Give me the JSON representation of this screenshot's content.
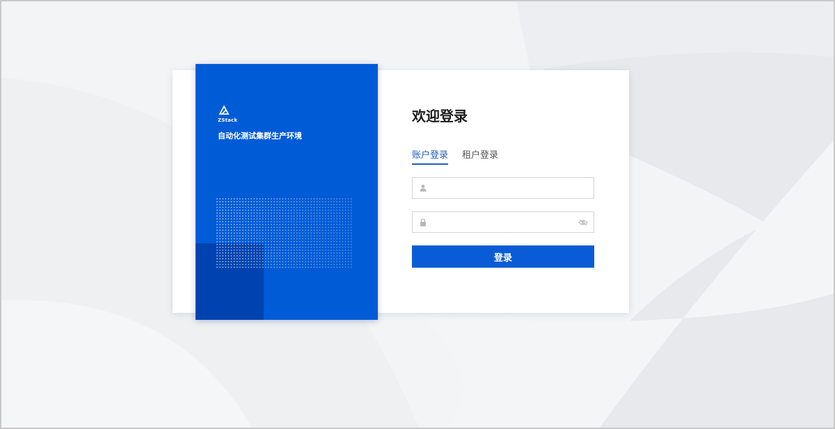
{
  "brand": {
    "logo_text": "ZStack",
    "environment_name": "自动化测试集群生产环境"
  },
  "login": {
    "title": "欢迎登录",
    "tabs": [
      {
        "label": "账户登录",
        "active": true
      },
      {
        "label": "租户登录",
        "active": false
      }
    ],
    "username": {
      "value": "",
      "placeholder": "",
      "icon": "user-icon"
    },
    "password": {
      "value": "",
      "placeholder": "",
      "icon": "lock-icon",
      "toggle_icon": "eye-hidden-icon"
    },
    "submit_label": "登录"
  },
  "colors": {
    "brand_blue": "#005bd6",
    "brand_dark_blue": "#0043b0",
    "button_blue": "#0a5cd6",
    "tab_active": "#1f5fbf",
    "background": "#f1f3f5"
  }
}
